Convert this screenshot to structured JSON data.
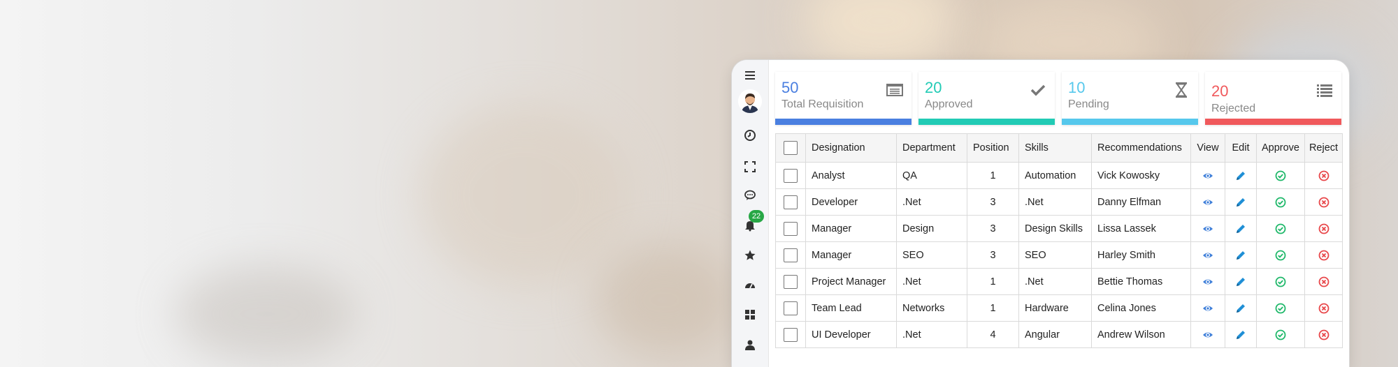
{
  "colors": {
    "blue": "#4a7fe0",
    "teal": "#22cbb5",
    "sky": "#56c8ec",
    "red": "#f0595c",
    "green": "#27a745"
  },
  "sidebar": {
    "icons": [
      "menu-icon",
      "avatar",
      "clock-icon",
      "fullscreen-icon",
      "chat-icon",
      "bell-icon",
      "star-icon",
      "dashboard-icon",
      "grid-icon",
      "user-icon"
    ],
    "notification_count": "22"
  },
  "cards": [
    {
      "count": "50",
      "label": "Total Requisition",
      "icon": "list-doc-icon",
      "color": "#4a7fe0"
    },
    {
      "count": "20",
      "label": "Approved",
      "icon": "check-icon",
      "color": "#22cbb5"
    },
    {
      "count": "10",
      "label": "Pending",
      "icon": "hourglass-icon",
      "color": "#56c8ec"
    },
    {
      "count": "20",
      "label": "Rejected",
      "icon": "list-icon",
      "color": "#f0595c"
    }
  ],
  "table": {
    "headers": [
      "Designation",
      "Department",
      "Position",
      "Skills",
      "Recommendations",
      "View",
      "Edit",
      "Approve",
      "Reject"
    ],
    "rows": [
      {
        "designation": "Analyst",
        "department": "QA",
        "position": "1",
        "skills": "Automation",
        "recommendation": "Vick Kowosky"
      },
      {
        "designation": "Developer",
        "department": ".Net",
        "position": "3",
        "skills": ".Net",
        "recommendation": "Danny Elfman"
      },
      {
        "designation": "Manager",
        "department": "Design",
        "position": "3",
        "skills": "Design Skills",
        "recommendation": "Lissa Lassek"
      },
      {
        "designation": "Manager",
        "department": "SEO",
        "position": "3",
        "skills": "SEO",
        "recommendation": "Harley Smith"
      },
      {
        "designation": "Project Manager",
        "department": ".Net",
        "position": "1",
        "skills": ".Net",
        "recommendation": "Bettie Thomas"
      },
      {
        "designation": "Team Lead",
        "department": "Networks",
        "position": "1",
        "skills": "Hardware",
        "recommendation": "Celina Jones"
      },
      {
        "designation": "UI Developer",
        "department": ".Net",
        "position": "4",
        "skills": "Angular",
        "recommendation": "Andrew Wilson"
      }
    ]
  }
}
